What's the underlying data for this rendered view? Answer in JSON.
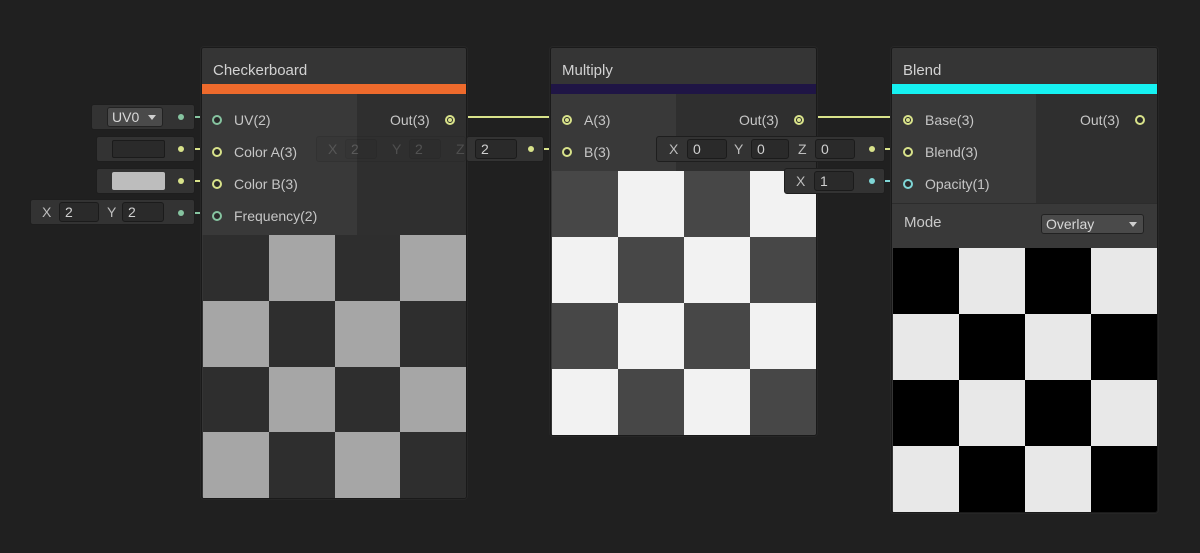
{
  "colors": {
    "checkerboard_accent": "#ee6a2c",
    "multiply_accent": "#1f1545",
    "blend_accent": "#16f2f2",
    "port_yellow": "#d8e28a",
    "port_green": "#86c4a0",
    "port_cyan": "#7fd6d6",
    "background": "#202020"
  },
  "nodes": {
    "checkerboard": {
      "title": "Checkerboard",
      "inputs": [
        "UV(2)",
        "Color A(3)",
        "Color B(3)",
        "Frequency(2)"
      ],
      "output": "Out(3)",
      "uv_value": "UV0",
      "color_a": "#2a2a2a",
      "color_b": "#bdbdbd",
      "frequency": {
        "x_label": "X",
        "x": "2",
        "y_label": "Y",
        "y": "2"
      },
      "preview": {
        "dark": "#2e2e2e",
        "light": "#a6a6a6"
      }
    },
    "multiply": {
      "title": "Multiply",
      "inputs": [
        "A(3)",
        "B(3)"
      ],
      "output": "Out(3)",
      "b_ghost": {
        "x_label": "X",
        "x": "2",
        "y_label": "Y",
        "y": "2",
        "z_label": "Z",
        "z": "2"
      },
      "preview": {
        "dark": "#474747",
        "light": "#f2f2f2"
      }
    },
    "blend": {
      "title": "Blend",
      "inputs": [
        "Base(3)",
        "Blend(3)",
        "Opacity(1)"
      ],
      "output": "Out(3)",
      "blend_vec": {
        "x_label": "X",
        "x": "0",
        "y_label": "Y",
        "y": "0",
        "z_label": "Z",
        "z": "0"
      },
      "opacity": {
        "x_label": "X",
        "x": "1"
      },
      "mode_label": "Mode",
      "mode_value": "Overlay",
      "preview": {
        "dark": "#000000",
        "light": "#e8e8e8"
      }
    }
  }
}
